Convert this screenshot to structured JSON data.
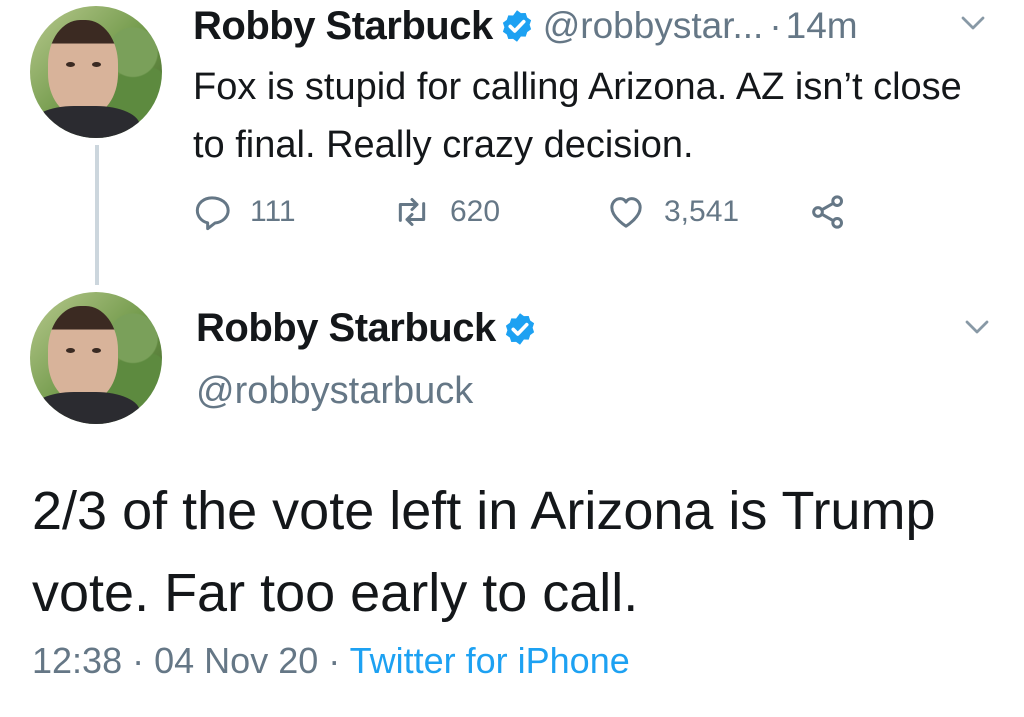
{
  "colors": {
    "text": "#14171a",
    "muted": "#657786",
    "link": "#1da1f2",
    "verified": "#1da1f2",
    "thread_line": "#ccd6dd"
  },
  "reply_tweet": {
    "author_name": "Robby Starbuck",
    "handle_truncated": "@robbystar...",
    "separator": "·",
    "time": "14m",
    "text": "Fox is stupid for calling Arizona. AZ isn’t close to final. Really crazy decision.",
    "actions": {
      "reply_count": "111",
      "retweet_count": "620",
      "like_count": "3,541"
    },
    "icons": [
      "verified-icon",
      "chevron-down-icon",
      "reply-icon",
      "retweet-icon",
      "like-icon",
      "share-icon"
    ]
  },
  "main_tweet": {
    "author_name": "Robby Starbuck",
    "handle": "@robbystarbuck",
    "text": "2/3 of the vote left in Arizona is Trump vote. Far too early to call.",
    "time": "12:38",
    "sep1": "·",
    "date": "04 Nov 20",
    "sep2": "·",
    "source": "Twitter for iPhone"
  }
}
